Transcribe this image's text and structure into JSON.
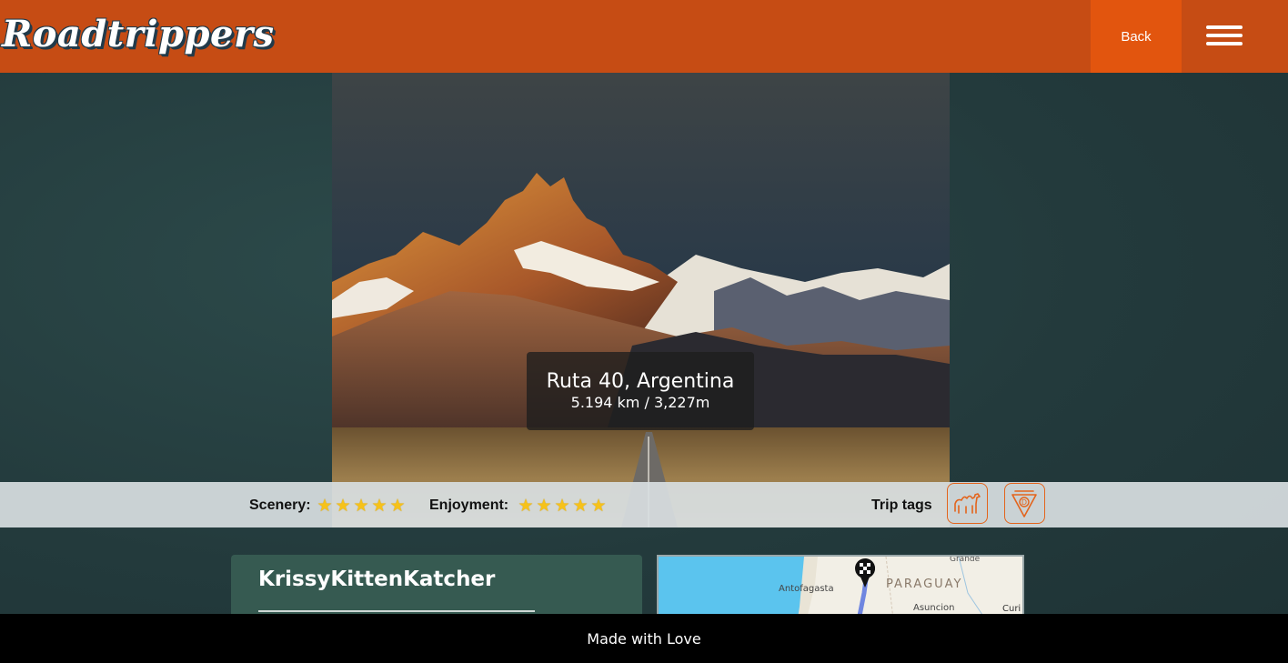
{
  "header": {
    "logo_text": "Roadtrippers",
    "back_label": "Back",
    "menu_icon": "hamburger-icon",
    "brand_color": "#c64c14",
    "back_color": "#e2550e"
  },
  "hero": {
    "title": "Ruta 40, Argentina",
    "distance": "5.194 km / 3,227m"
  },
  "ratings": {
    "scenery_label": "Scenery:",
    "scenery_stars": "★★★★★",
    "scenery_value": 5,
    "enjoyment_label": "Enjoyment:",
    "enjoyment_stars": "★★★★★",
    "enjoyment_value": 5,
    "trip_tags_label": "Trip tags",
    "tags": [
      "camel-icon",
      "dispatch-badge-icon"
    ]
  },
  "user": {
    "name": "KrissyKittenKatcher"
  },
  "map": {
    "labels": [
      "Grande",
      "Antofagasta",
      "PARAGUAY",
      "Asuncion",
      "Curi"
    ],
    "marker_icon": "checkered-flag-pin-icon"
  },
  "footer": {
    "text": "Made with Love"
  }
}
